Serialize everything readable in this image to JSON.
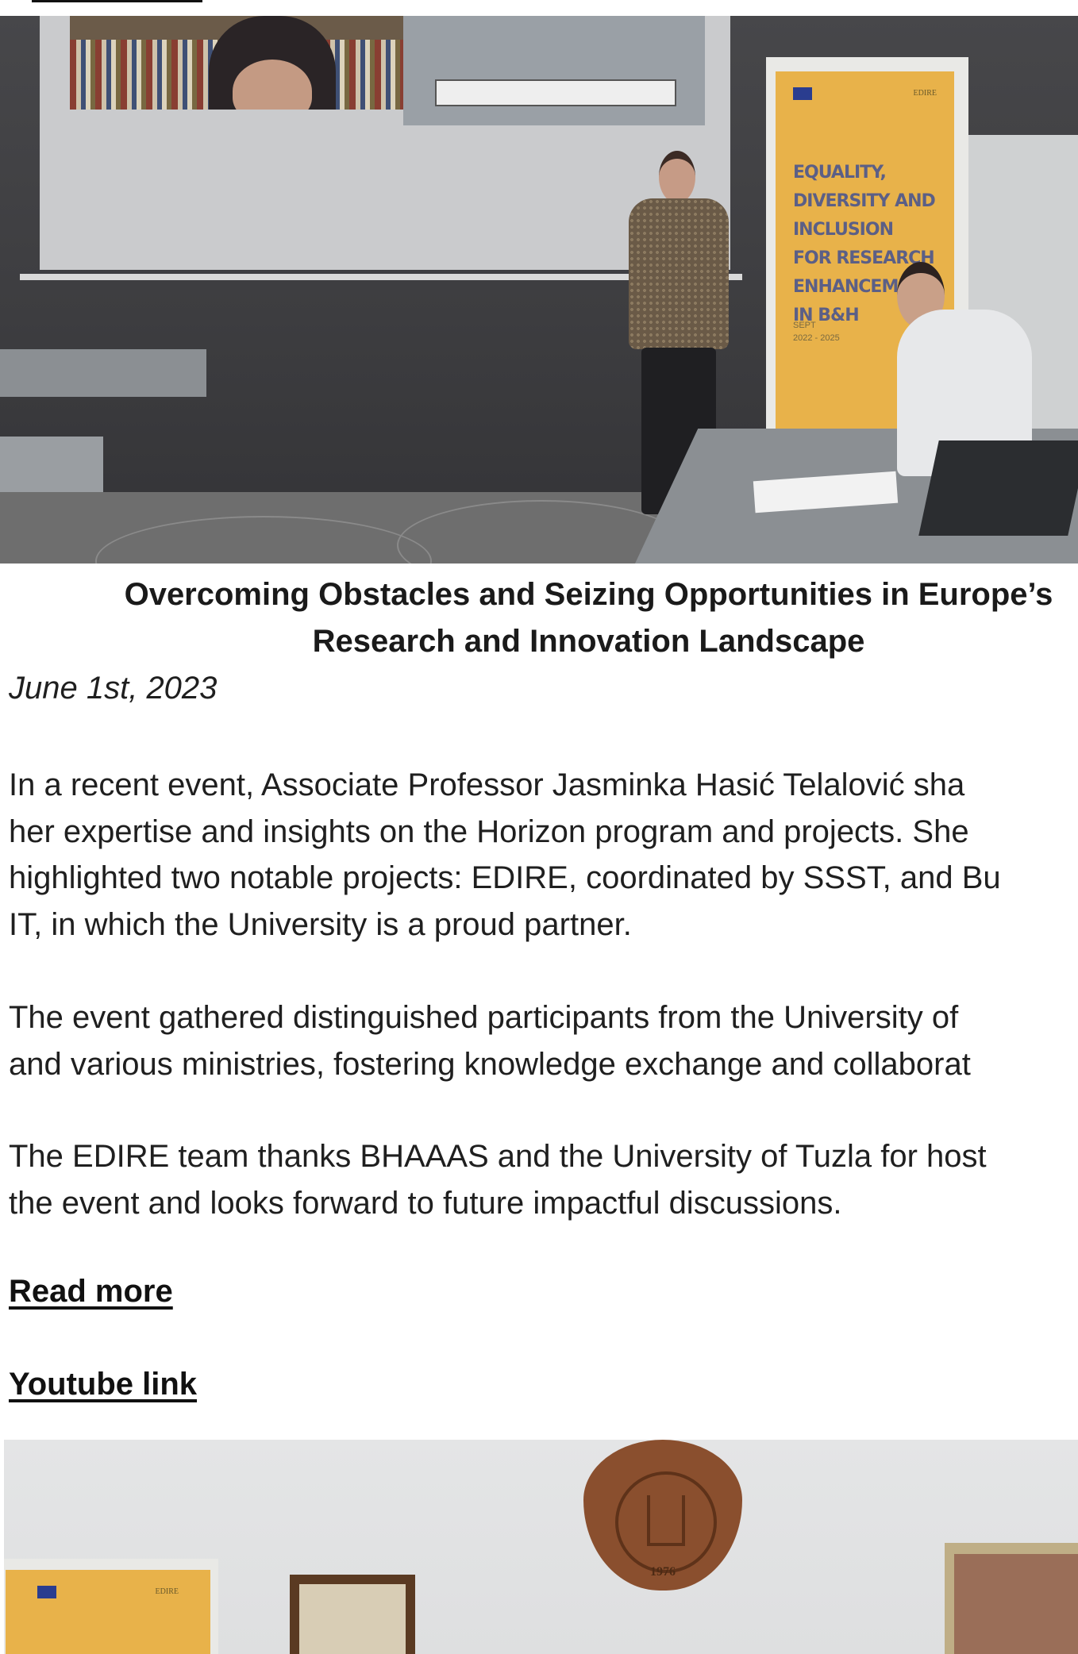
{
  "photo_top": {
    "alt": "",
    "banner": {
      "brand": "EDIRE",
      "lines": [
        "EQUALITY,",
        "DIVERSITY AND",
        "INCLUSION",
        "FOR RESEARCH",
        "ENHANCEME",
        "IN B&H"
      ],
      "date_label": "SEPT",
      "date_range": "2022 - 2025"
    }
  },
  "article": {
    "headline_line1": "Overcoming Obstacles and Seizing Opportunities in Europe’s",
    "headline_line2": "Research and Innovation Landscape",
    "date": "June 1st, 2023",
    "paragraph1_lines": [
      "In a recent event, Associate Professor Jasminka Hasić Telalović sha",
      "her expertise and insights on the Horizon program and projects. She",
      "highlighted two notable projects: EDIRE, coordinated by SSST, and Bu",
      "IT, in which the University is a proud partner."
    ],
    "paragraph2_lines": [
      "The event gathered distinguished participants from the University of",
      "and various ministries, fostering knowledge exchange and collaborat"
    ],
    "paragraph3_lines": [
      "The EDIRE team thanks BHAAAS and the University of Tuzla for host",
      "the event and looks forward to future impactful discussions."
    ],
    "read_more_label": "Read more",
    "youtube_link_label": "Youtube link"
  },
  "photo_bottom": {
    "banner_brand": "EDIRE",
    "plaque_text": "1976"
  }
}
